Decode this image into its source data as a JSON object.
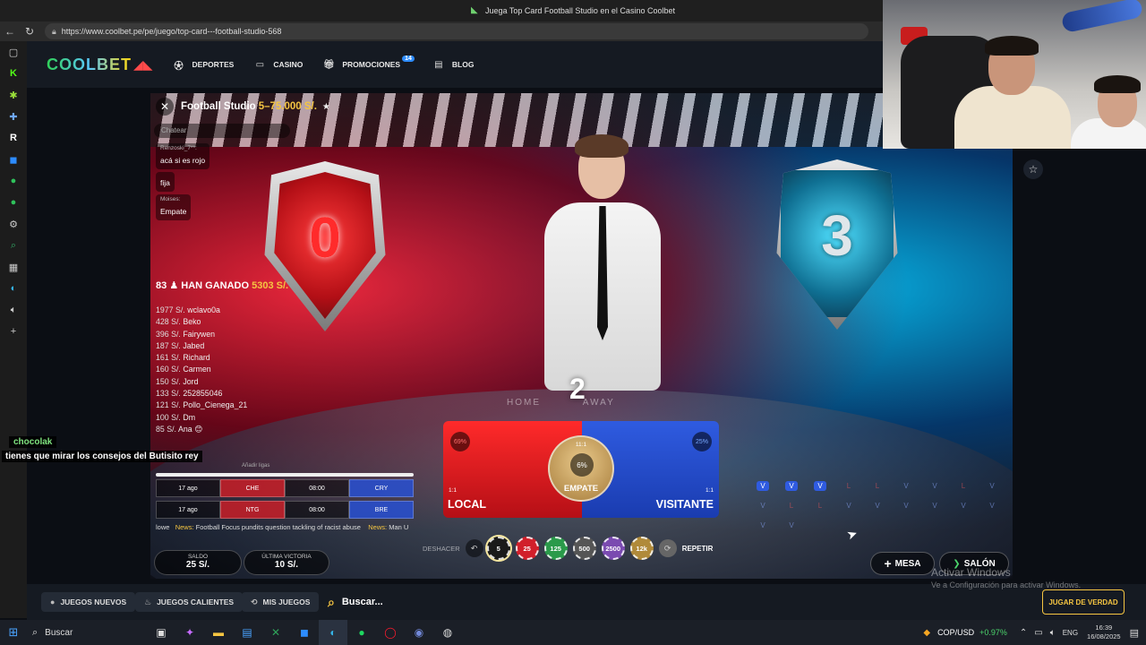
{
  "browser": {
    "window_title": "Juega Top Card Football Studio en el Casino Coolbet",
    "url": "https://www.coolbet.pe/pe/juego/top-card---football-studio-568"
  },
  "site": {
    "logo": "COOLBET",
    "nav": [
      {
        "label": "DEPORTES",
        "icon": "sports-icon"
      },
      {
        "label": "CASINO",
        "icon": "casino-icon"
      },
      {
        "label": "PROMOCIONES",
        "icon": "gift-icon",
        "badge": "14"
      },
      {
        "label": "BLOG",
        "icon": "blog-icon"
      }
    ]
  },
  "game": {
    "title": "Football Studio",
    "limits": "5–75.000 S/.",
    "chat_placeholder": "Chatear",
    "chat": [
      {
        "user": "Renzoski_7**:",
        "text": "acá si es rojo"
      },
      {
        "user": "",
        "text": "fija"
      },
      {
        "user": "Moises:",
        "text": "Empate"
      }
    ],
    "home_card": "0",
    "away_card": "3",
    "score_card": "2",
    "home_label": "HOME",
    "away_label": "AWAY",
    "winners_count": "83",
    "winners_label": "HAN GANADO",
    "winners_amount": "5303 S/.",
    "winners": [
      {
        "amount": "1977 S/.",
        "name": "wclavo0a"
      },
      {
        "amount": "428 S/.",
        "name": "Beko"
      },
      {
        "amount": "396 S/.",
        "name": "Fairywen"
      },
      {
        "amount": "187 S/.",
        "name": "Jabed"
      },
      {
        "amount": "161 S/.",
        "name": "Richard"
      },
      {
        "amount": "160 S/.",
        "name": "Carmen"
      },
      {
        "amount": "150 S/.",
        "name": "Jord"
      },
      {
        "amount": "133 S/.",
        "name": "252855046"
      },
      {
        "amount": "121 S/.",
        "name": "Pollo_Cienega_21"
      },
      {
        "amount": "100 S/.",
        "name": "Dm"
      },
      {
        "amount": "85 S/.",
        "name": "Ana 😊"
      }
    ],
    "schedule_header": "Añadir ligas",
    "schedule": [
      {
        "date": "17 ago",
        "home": "CHE",
        "time": "08:00",
        "away": "CRY"
      },
      {
        "date": "17 ago",
        "home": "NTG",
        "time": "08:00",
        "away": "BRE"
      }
    ],
    "ticker": [
      {
        "prefix": "lowe",
        "tag": "News:",
        "text": "Football Focus pundits question tackling of racist abuse"
      },
      {
        "prefix": "",
        "tag": "News:",
        "text": "Man U"
      }
    ],
    "bets": {
      "local": {
        "label": "LOCAL",
        "odds": "1:1",
        "pct": "69%"
      },
      "tie": {
        "label": "EMPATE",
        "odds": "11:1",
        "pct": "6%"
      },
      "visitor": {
        "label": "VISITANTE",
        "odds": "1:1",
        "pct": "25%"
      }
    },
    "roadmap": [
      [
        "V",
        "V",
        "V",
        "L",
        "L",
        "V",
        "V",
        "L",
        "V"
      ],
      [
        "V",
        "L",
        "L",
        "V",
        "V",
        "V",
        "V",
        "V",
        "V"
      ],
      [
        "V",
        "V",
        "",
        "",
        "",
        "",
        "",
        "",
        ""
      ]
    ],
    "controls": {
      "undo": "DESHACER",
      "chips": [
        {
          "value": "5",
          "color": "#222222",
          "selected": true
        },
        {
          "value": "25",
          "color": "#d11f2a"
        },
        {
          "value": "125",
          "color": "#2a9a4a"
        },
        {
          "value": "500",
          "color": "#555555"
        },
        {
          "value": "2500",
          "color": "#7a4ab0"
        },
        {
          "value": "12k",
          "color": "#b08a3a"
        }
      ],
      "repeat": "REPETIR"
    },
    "balance": {
      "label": "SALDO",
      "value": "25 S/."
    },
    "last_win": {
      "label": "ÚLTIMA VICTORIA",
      "value": "10 S/."
    },
    "table_button": "MESA",
    "lobby_button": "SALÓN"
  },
  "stream_chat": {
    "user": "chocolak",
    "message": "tienes que mirar los consejos del Butisito rey"
  },
  "bottom_nav": {
    "items": [
      {
        "label": "JUEGOS NUEVOS",
        "icon": "new-games-icon"
      },
      {
        "label": "JUEGOS CALIENTES",
        "icon": "fire-icon"
      },
      {
        "label": "MIS JUEGOS",
        "icon": "history-icon"
      }
    ],
    "search": "Buscar...",
    "play_real": "JUGAR DE VERDAD"
  },
  "watermark": {
    "line1": "Activar Windows",
    "line2": "Ve a Configuración para activar Windows."
  },
  "taskbar": {
    "search": "Buscar",
    "currency": "COP/USD",
    "change": "+0.97%",
    "lang": "ENG",
    "time": "16:39",
    "date": "16/08/2025"
  }
}
